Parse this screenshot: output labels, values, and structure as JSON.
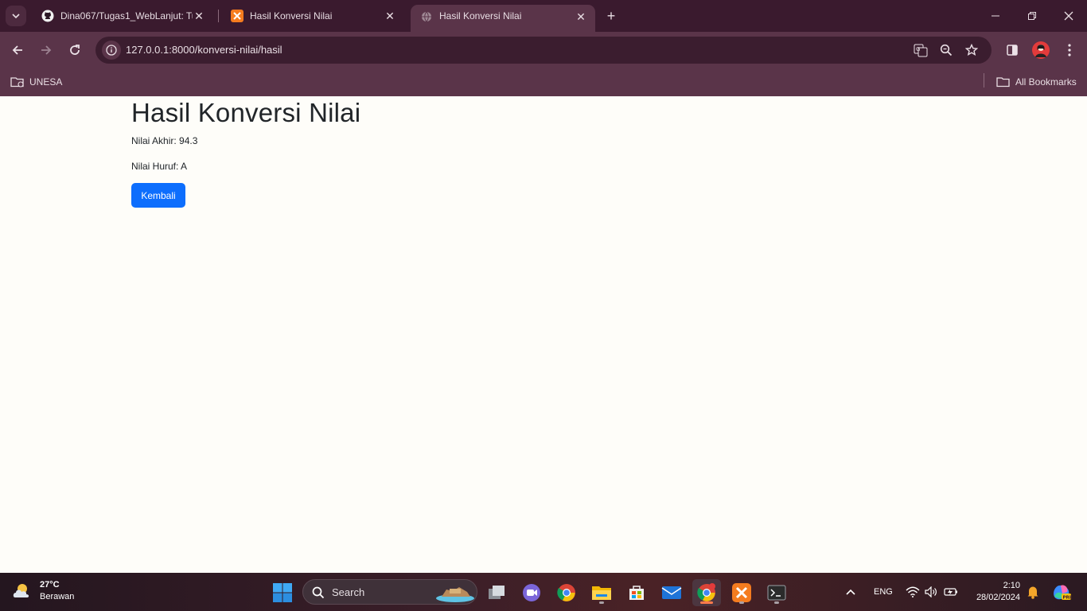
{
  "browser": {
    "tabs": [
      {
        "title": "Dina067/Tugas1_WebLanjut: Tu"
      },
      {
        "title": "Hasil Konversi Nilai"
      },
      {
        "title": "Hasil Konversi Nilai"
      }
    ],
    "url": "127.0.0.1:8000/konversi-nilai/hasil",
    "bookmarks": {
      "left": "UNESA",
      "right": "All Bookmarks"
    }
  },
  "page": {
    "heading": "Hasil Konversi Nilai",
    "final_score_label": "Nilai Akhir: 94.3",
    "letter_grade_label": "Nilai Huruf: A",
    "back_button": "Kembali"
  },
  "taskbar": {
    "weather_temp": "27°C",
    "weather_desc": "Berawan",
    "search_label": "Search",
    "language": "ENG",
    "time": "2:10",
    "date": "28/02/2024"
  },
  "colors": {
    "chrome_dark": "#3a1a2e",
    "chrome_toolbar": "#5a3449",
    "primary_button": "#0d6efd"
  }
}
